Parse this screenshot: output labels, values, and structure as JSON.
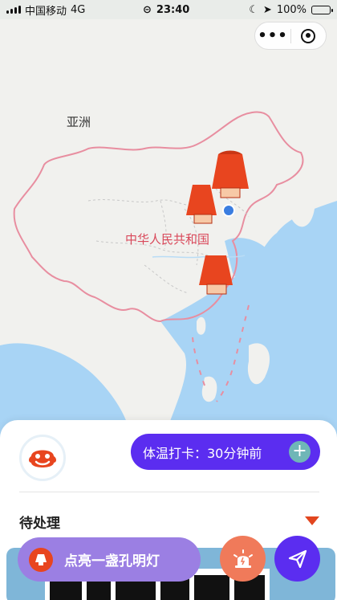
{
  "status_bar": {
    "carrier": "中国移动",
    "network": "4G",
    "time": "23:40",
    "battery": "100%"
  },
  "map": {
    "labels": {
      "asia": "亚洲",
      "country": "中华人民共和国"
    },
    "markers": [
      "lantern-marker",
      "lantern-marker",
      "lantern-marker",
      "location-pin"
    ]
  },
  "capsule": {
    "more": "•••"
  },
  "sheet": {
    "temperature_checkin": "体温打卡：30分钟前",
    "pending_label": "待处理",
    "light_lantern_label": "点亮一盏孔明灯"
  },
  "colors": {
    "accent": "#5b2df0",
    "lantern": "#e8451f",
    "border_red": "#e88ea0",
    "sea": "#a8d4f5",
    "land": "#f1f1ee"
  }
}
